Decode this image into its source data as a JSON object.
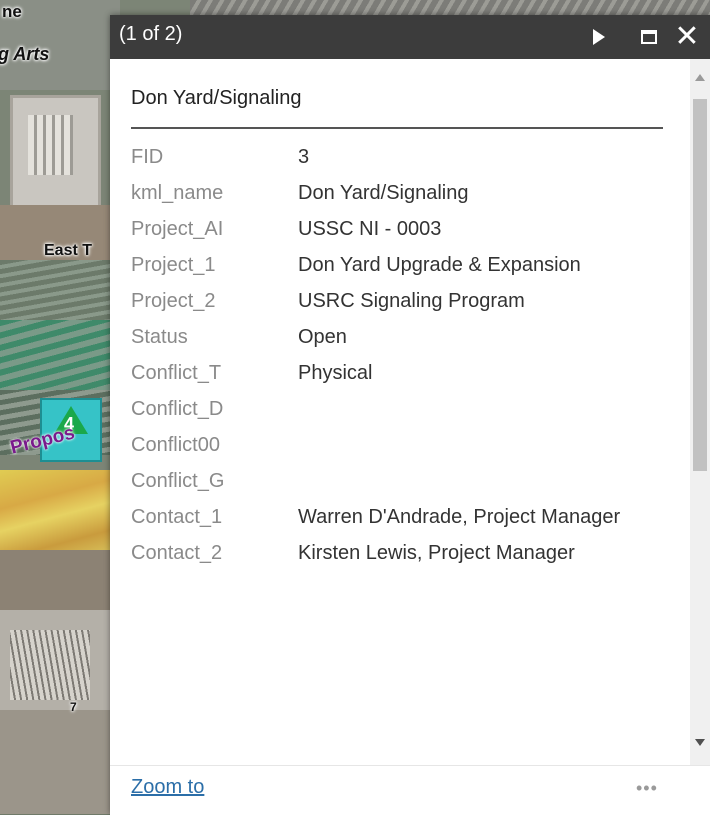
{
  "map": {
    "labels": {
      "arts": "g Arts",
      "top": "ne",
      "east": "East T",
      "proposed": "Propos",
      "marker_number": "4",
      "lot_number": "7"
    }
  },
  "popup": {
    "counter": "(1 of 2)",
    "title": "Don Yard/Signaling",
    "attributes": [
      {
        "key": "FID",
        "value": "3"
      },
      {
        "key": "kml_name",
        "value": "Don Yard/Signaling"
      },
      {
        "key": "Project_AI",
        "value": "USSC NI - 0003"
      },
      {
        "key": "Project_1",
        "value": "Don Yard Upgrade & Expansion"
      },
      {
        "key": "Project_2",
        "value": "USRC Signaling Program"
      },
      {
        "key": "Status",
        "value": "Open"
      },
      {
        "key": "Conflict_T",
        "value": "Physical"
      },
      {
        "key": "Conflict_D",
        "value": ""
      },
      {
        "key": "Conflict00",
        "value": ""
      },
      {
        "key": "Conflict_G",
        "value": ""
      },
      {
        "key": "Contact_1",
        "value": "Warren D'Andrade, Project Manager"
      },
      {
        "key": "Contact_2",
        "value": "Kirsten Lewis, Project Manager"
      }
    ],
    "footer": {
      "zoom_label": "Zoom to",
      "more_label": "•••"
    },
    "icons": {
      "next": "play-icon",
      "maximize": "maximize-icon",
      "close": "close-icon"
    },
    "close_label": "✕"
  }
}
